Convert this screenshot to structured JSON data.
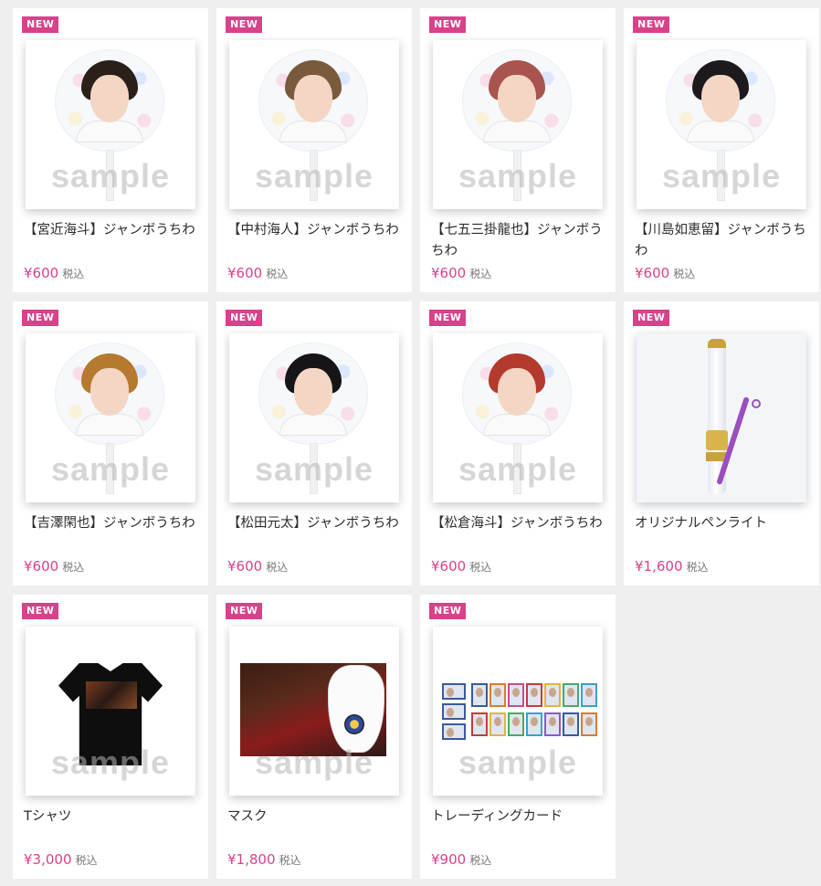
{
  "products": [
    {
      "badge": "NEW",
      "name": "【宮近海斗】ジャンボうちわ",
      "price": "¥600",
      "tax": "税込",
      "watermark": "sample",
      "image": "uchiwa",
      "hair": "#2b1f1a"
    },
    {
      "badge": "NEW",
      "name": "【中村海人】ジャンボうちわ",
      "price": "¥600",
      "tax": "税込",
      "watermark": "sample",
      "image": "uchiwa",
      "hair": "#7a5a3c"
    },
    {
      "badge": "NEW",
      "name": "【七五三掛龍也】ジャンボうちわ",
      "price": "¥600",
      "tax": "税込",
      "watermark": "sample",
      "image": "uchiwa",
      "hair": "#a9544e"
    },
    {
      "badge": "NEW",
      "name": "【川島如恵留】ジャンボうちわ",
      "price": "¥600",
      "tax": "税込",
      "watermark": "sample",
      "image": "uchiwa",
      "hair": "#1c1a1c"
    },
    {
      "badge": "NEW",
      "name": "【吉澤閑也】ジャンボうちわ",
      "price": "¥600",
      "tax": "税込",
      "watermark": "sample",
      "image": "uchiwa",
      "hair": "#b57a2e"
    },
    {
      "badge": "NEW",
      "name": "【松田元太】ジャンボうちわ",
      "price": "¥600",
      "tax": "税込",
      "watermark": "sample",
      "image": "uchiwa",
      "hair": "#161416"
    },
    {
      "badge": "NEW",
      "name": "【松倉海斗】ジャンボうちわ",
      "price": "¥600",
      "tax": "税込",
      "watermark": "sample",
      "image": "uchiwa",
      "hair": "#b33a2c"
    },
    {
      "badge": "NEW",
      "name": "オリジナルペンライト",
      "price": "¥1,600",
      "tax": "税込",
      "watermark": "",
      "image": "penlight"
    },
    {
      "badge": "NEW",
      "name": "Tシャツ",
      "price": "¥3,000",
      "tax": "税込",
      "watermark": "sample",
      "image": "tshirt"
    },
    {
      "badge": "NEW",
      "name": "マスク",
      "price": "¥1,800",
      "tax": "税込",
      "watermark": "sample",
      "image": "mask"
    },
    {
      "badge": "NEW",
      "name": "トレーディングカード",
      "price": "¥900",
      "tax": "税込",
      "watermark": "sample",
      "image": "cards"
    }
  ],
  "colors": {
    "accent": "#d9418a",
    "card_borders": [
      "#3a5a9a",
      "#e07a2a",
      "#c94a8a",
      "#c93a3a",
      "#e0b53a",
      "#4aa86a",
      "#3aa0c9",
      "#8a5ac9"
    ]
  }
}
